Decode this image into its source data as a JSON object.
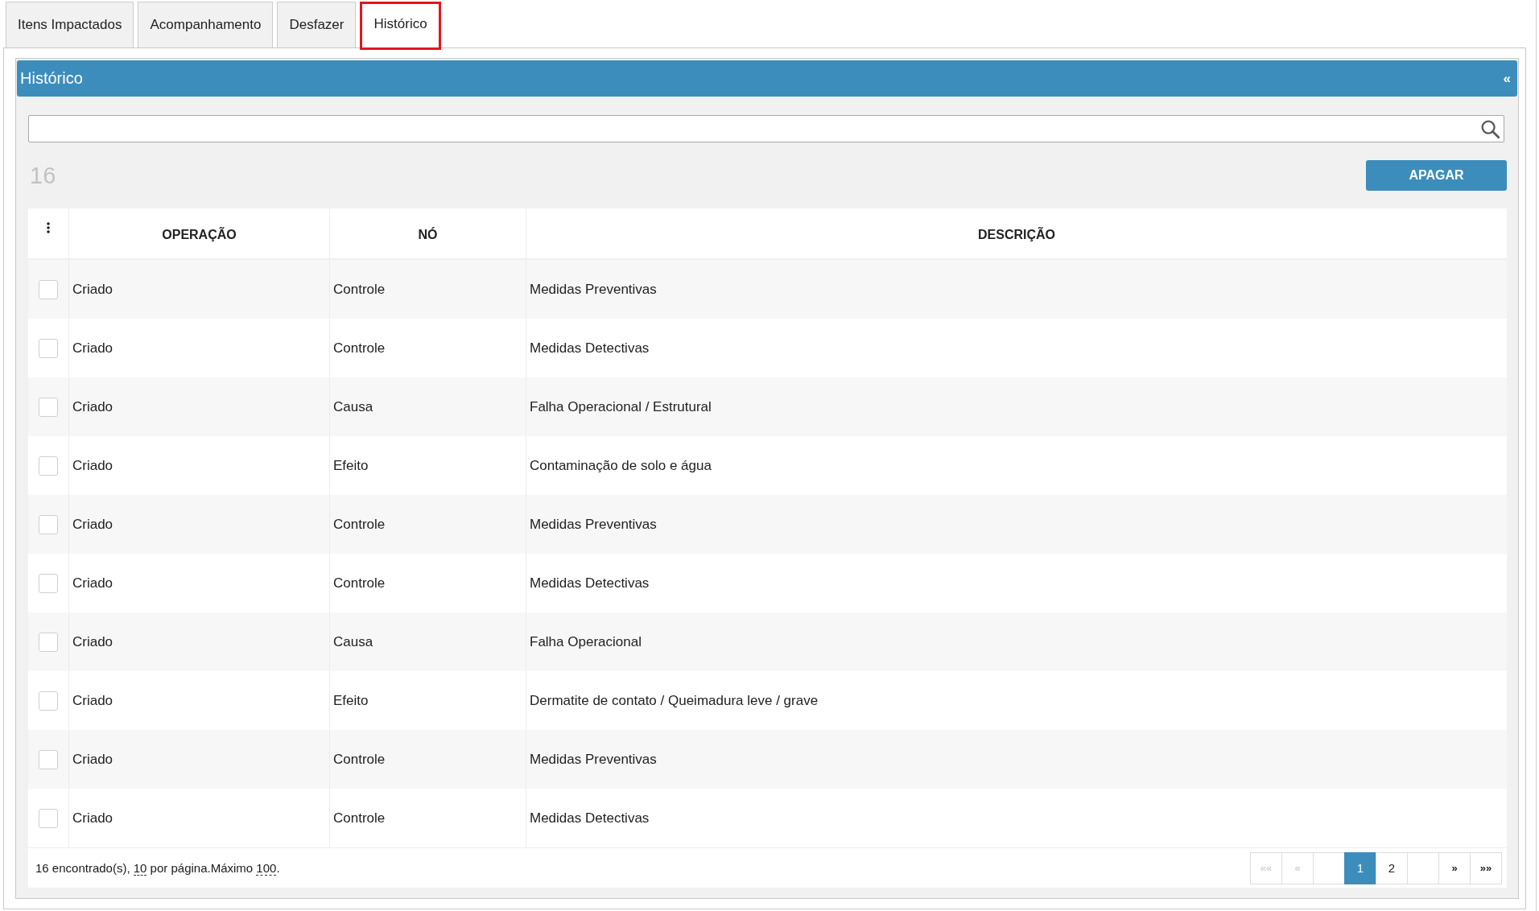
{
  "tabs": [
    {
      "label": "Itens Impactados",
      "selected": false
    },
    {
      "label": "Acompanhamento",
      "selected": false
    },
    {
      "label": "Desfazer",
      "selected": false
    },
    {
      "label": "Histórico",
      "selected": true
    }
  ],
  "panel": {
    "title": "Histórico",
    "collapse_symbol": "«",
    "count": "16",
    "delete_button": "APAGAR",
    "table": {
      "columns": [
        "OPERAÇÃO",
        "NÓ",
        "DESCRIÇÃO"
      ],
      "rows": [
        {
          "checked": false,
          "cells": [
            "Criado",
            "Controle",
            "Medidas Preventivas"
          ]
        },
        {
          "checked": false,
          "cells": [
            "Criado",
            "Controle",
            "Medidas Detectivas"
          ]
        },
        {
          "checked": false,
          "cells": [
            "Criado",
            "Causa",
            "Falha Operacional / Estrutural"
          ]
        },
        {
          "checked": false,
          "cells": [
            "Criado",
            "Efeito",
            "Contaminação de solo e água"
          ]
        },
        {
          "checked": false,
          "cells": [
            "Criado",
            "Controle",
            "Medidas Preventivas"
          ]
        },
        {
          "checked": false,
          "cells": [
            "Criado",
            "Controle",
            "Medidas Detectivas"
          ]
        },
        {
          "checked": false,
          "cells": [
            "Criado",
            "Causa",
            "Falha Operacional"
          ]
        },
        {
          "checked": false,
          "cells": [
            "Criado",
            "Efeito",
            "Dermatite de contato / Queimadura leve / grave"
          ]
        },
        {
          "checked": false,
          "cells": [
            "Criado",
            "Controle",
            "Medidas Preventivas"
          ]
        },
        {
          "checked": false,
          "cells": [
            "Criado",
            "Controle",
            "Medidas Detectivas"
          ]
        }
      ]
    },
    "footer": {
      "summary": [
        {
          "kind": "plain",
          "text": "16 encontrado(s), "
        },
        {
          "kind": "link",
          "text": "10"
        },
        {
          "kind": "plain",
          "text": " por página.Máximo "
        },
        {
          "kind": "link",
          "text": "100"
        },
        {
          "kind": "plain",
          "text": "."
        }
      ],
      "pagination": [
        {
          "kind": "first",
          "label": "««",
          "disabled": true,
          "selected": false
        },
        {
          "kind": "prev",
          "label": "«",
          "disabled": true,
          "selected": false
        },
        {
          "kind": "blank"
        },
        {
          "kind": "page",
          "label": "1",
          "disabled": false,
          "selected": true
        },
        {
          "kind": "page",
          "label": "2",
          "disabled": false,
          "selected": false
        },
        {
          "kind": "blank"
        },
        {
          "kind": "next",
          "label": "»",
          "disabled": false,
          "selected": false
        },
        {
          "kind": "last",
          "label": "»»",
          "disabled": false,
          "selected": false
        }
      ]
    }
  }
}
